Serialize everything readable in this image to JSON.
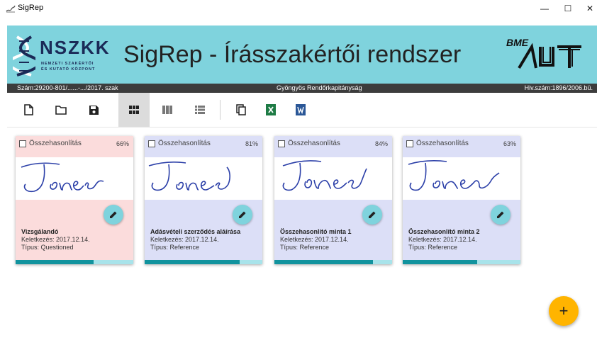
{
  "window": {
    "title": "SigRep",
    "minimize_glyph": "—",
    "maximize_glyph": "☐",
    "close_glyph": "✕"
  },
  "header": {
    "logo_big": "NSZKK",
    "logo_small_line1": "NEMZETI SZAKÉRTŐI",
    "logo_small_line2": "ÉS KUTATÓ KÖZPONT",
    "app_heading": "SigRep - Írásszakértői rendszer",
    "bme_text": "BME"
  },
  "infobar": {
    "case_number": "Szám:29200-801/......-.../2017. szak",
    "authority": "Gyöngyös Rendőrkapitányság",
    "ref_number": "Hiv.szám:1896/2006.bü."
  },
  "toolbar": {
    "icons": [
      "new-file-icon",
      "open-folder-icon",
      "save-icon",
      "grid-view-icon",
      "column-view-icon",
      "list-view-icon",
      "copy-icon",
      "excel-export-icon",
      "word-export-icon"
    ]
  },
  "colors": {
    "banner": "#7fd3dd",
    "infobar": "#3c3c3c",
    "questioned_bg": "#fbdcdc",
    "reference_bg": "#dcdff7",
    "progress_fill": "#11939e",
    "progress_track": "#a8e3ea",
    "fab_add": "#ffb400",
    "ink": "#2b3fa8"
  },
  "cards": [
    {
      "checkbox_label": "Összehasonlítás",
      "percent": "66%",
      "progress": 0.66,
      "signature_text": "Jones",
      "name": "Vizsgálandó",
      "date_line": "Keletkezés: 2017.12.14.",
      "type_line": "Típus: Questioned"
    },
    {
      "checkbox_label": "Összehasonlítás",
      "percent": "81%",
      "progress": 0.81,
      "signature_text": "Jones",
      "name": "Adásvételi szerződés aláírása",
      "date_line": "Keletkezés: 2017.12.14.",
      "type_line": "Típus: Reference"
    },
    {
      "checkbox_label": "Összehasonlítás",
      "percent": "84%",
      "progress": 0.84,
      "signature_text": "Jones",
      "name": "Összehasonlító minta 1",
      "date_line": "Keletkezés: 2017.12.14.",
      "type_line": "Típus: Reference"
    },
    {
      "checkbox_label": "Összehasonlítás",
      "percent": "63%",
      "progress": 0.63,
      "signature_text": "Jones",
      "name": "Összehasonlító minta 2",
      "date_line": "Keletkezés: 2017.12.14.",
      "type_line": "Típus: Reference"
    }
  ],
  "fab": {
    "add_glyph": "+"
  }
}
